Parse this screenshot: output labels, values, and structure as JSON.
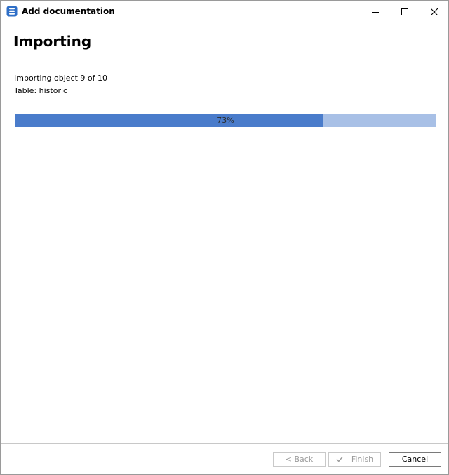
{
  "window": {
    "title": "Add documentation",
    "icon": "app-database-doc-icon"
  },
  "titlebar_buttons": {
    "minimize_icon": "minimize-icon",
    "maximize_icon": "maximize-icon",
    "close_icon": "close-icon"
  },
  "page": {
    "heading": "Importing",
    "status_line_1": "Importing object 9 of 10",
    "status_line_2": "Table: historic"
  },
  "progress": {
    "value": 0.73,
    "label": "73%",
    "fill_color": "#4a7ccb",
    "track_color": "#a8c0e6"
  },
  "footer": {
    "back_label": "< Back",
    "finish_label": "Finish",
    "finish_icon": "check-icon",
    "cancel_label": "Cancel"
  }
}
